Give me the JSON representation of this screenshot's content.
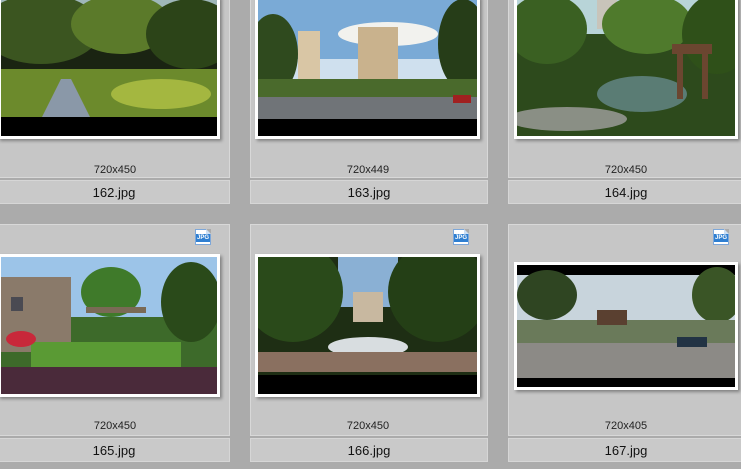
{
  "thumbnails": [
    {
      "dims": "720x450",
      "name": "162.jpg",
      "badge": ""
    },
    {
      "dims": "720x449",
      "name": "163.jpg",
      "badge": ""
    },
    {
      "dims": "720x450",
      "name": "164.jpg",
      "badge": ""
    },
    {
      "dims": "720x450",
      "name": "165.jpg",
      "badge": "JPG"
    },
    {
      "dims": "720x450",
      "name": "166.jpg",
      "badge": "JPG"
    },
    {
      "dims": "720x405",
      "name": "167.jpg",
      "badge": "JPG"
    }
  ]
}
